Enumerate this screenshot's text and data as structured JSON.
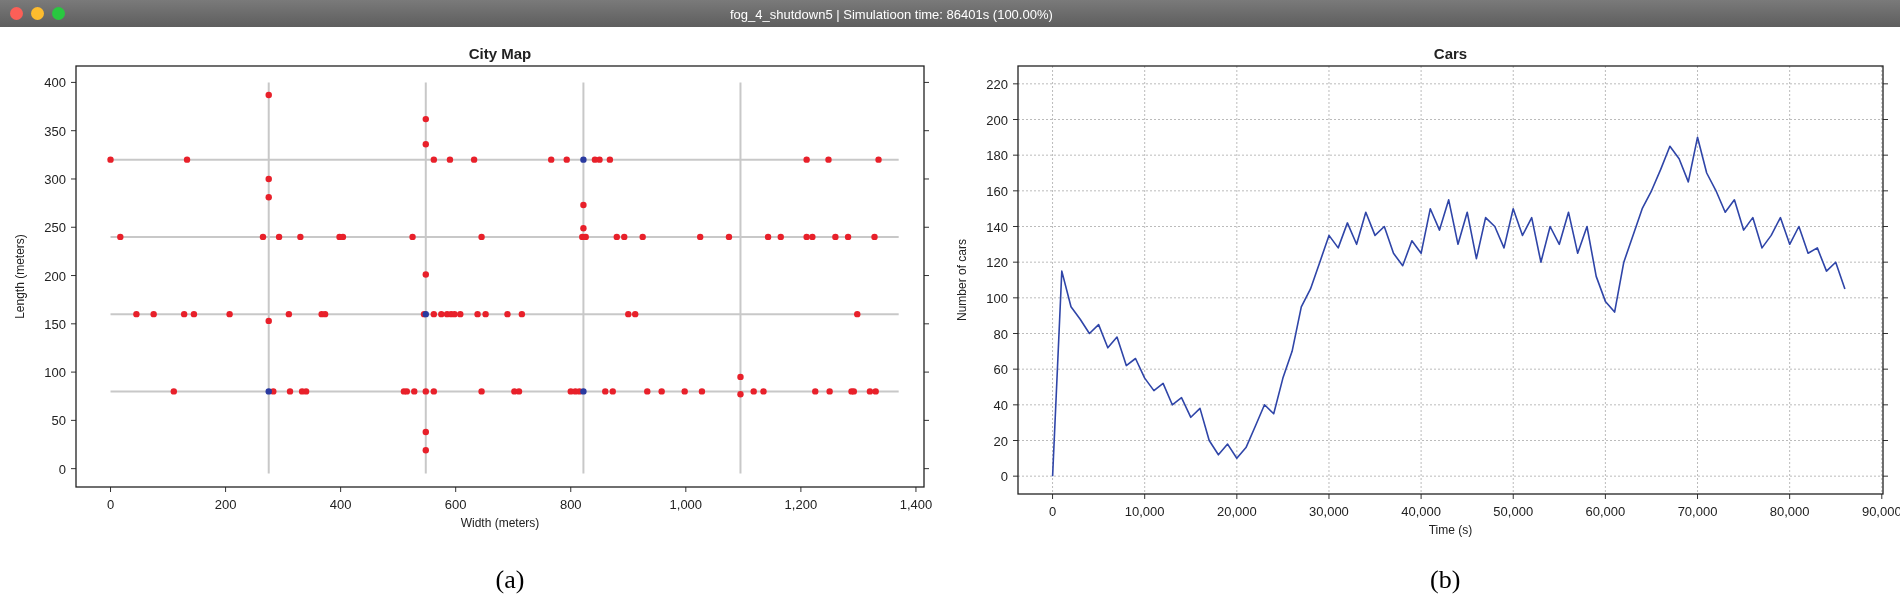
{
  "window": {
    "title": "fog_4_shutdown5 | Simulatioon time: 86401s (100.00%)"
  },
  "city_map": {
    "chart_data": {
      "type": "scatter",
      "title": "City Map",
      "xlabel": "Width (meters)",
      "ylabel": "Length (meters)",
      "xlim": [
        -60,
        1414
      ],
      "ylim": [
        -19,
        417
      ],
      "xticks": [
        0,
        200,
        400,
        600,
        800,
        {
          "value": 1000,
          "label": "1,000"
        },
        {
          "value": 1200,
          "label": "1,200"
        },
        {
          "value": 1400,
          "label": "1,400"
        }
      ],
      "yticks": [
        0,
        50,
        100,
        150,
        200,
        250,
        300,
        350,
        400
      ],
      "series": [
        {
          "color": "#e8202a",
          "x": [
            0,
            133,
            562,
            590,
            632,
            766,
            793,
            842,
            850,
            868,
            1210,
            1248,
            1335,
            275,
            275,
            275,
            275,
            548,
            548,
            548,
            548,
            548,
            822,
            822,
            1095,
            1095,
            17,
            265,
            293,
            330,
            398,
            404,
            525,
            645,
            820,
            826,
            880,
            893,
            925,
            1025,
            1075,
            1143,
            1165,
            1210,
            1220,
            1260,
            1282,
            1328,
            45,
            75,
            128,
            145,
            207,
            310,
            367,
            373,
            545,
            562,
            575,
            585,
            592,
            598,
            608,
            638,
            652,
            690,
            715,
            900,
            912,
            1298,
            110,
            283,
            312,
            333,
            340,
            510,
            515,
            528,
            548,
            562,
            645,
            702,
            710,
            800,
            808,
            815,
            860,
            873,
            933,
            958,
            998,
            1028,
            1118,
            1135,
            1225,
            1250,
            1288,
            1292,
            1320,
            1330
          ],
          "values": [
            320,
            320,
            320,
            320,
            320,
            320,
            320,
            320,
            320,
            320,
            320,
            320,
            320,
            387,
            300,
            281,
            153,
            362,
            336,
            201,
            38,
            19,
            273,
            249,
            95,
            77,
            240,
            240,
            240,
            240,
            240,
            240,
            240,
            240,
            240,
            240,
            240,
            240,
            240,
            240,
            240,
            240,
            240,
            240,
            240,
            240,
            240,
            240,
            160,
            160,
            160,
            160,
            160,
            160,
            160,
            160,
            160,
            160,
            160,
            160,
            160,
            160,
            160,
            160,
            160,
            160,
            160,
            160,
            160,
            160,
            80,
            80,
            80,
            80,
            80,
            80,
            80,
            80,
            80,
            80,
            80,
            80,
            80,
            80,
            80,
            80,
            80,
            80,
            80,
            80,
            80,
            80,
            80,
            80,
            80,
            80,
            80,
            80,
            80,
            80
          ]
        },
        {
          "color": "#2a3aa0",
          "x": [
            822,
            548,
            275,
            822
          ],
          "values": [
            320,
            160,
            80,
            80
          ]
        }
      ],
      "ref_lines": [
        {
          "axis": "y",
          "value": 80
        },
        {
          "axis": "y",
          "value": 160
        },
        {
          "axis": "y",
          "value": 240
        },
        {
          "axis": "y",
          "value": 320
        },
        {
          "axis": "x",
          "value": 275
        },
        {
          "axis": "x",
          "value": 548
        },
        {
          "axis": "x",
          "value": 822
        },
        {
          "axis": "x",
          "value": 1095
        }
      ]
    }
  },
  "cars": {
    "chart_data": {
      "type": "line",
      "title": "Cars",
      "xlabel": "Time (s)",
      "ylabel": "Number of cars",
      "xlim": [
        -3750,
        90130
      ],
      "ylim": [
        -10,
        230
      ],
      "xticks": [
        0,
        {
          "value": 10000,
          "label": "10,000"
        },
        {
          "value": 20000,
          "label": "20,000"
        },
        {
          "value": 30000,
          "label": "30,000"
        },
        {
          "value": 40000,
          "label": "40,000"
        },
        {
          "value": 50000,
          "label": "50,000"
        },
        {
          "value": 60000,
          "label": "60,000"
        },
        {
          "value": 70000,
          "label": "70,000"
        },
        {
          "value": 80000,
          "label": "80,000"
        },
        {
          "value": 90000,
          "label": "90,000"
        }
      ],
      "yticks": [
        0,
        20,
        40,
        60,
        80,
        100,
        120,
        140,
        160,
        180,
        200,
        220
      ],
      "x": [
        0,
        1000,
        2000,
        3000,
        4000,
        5000,
        6000,
        7000,
        8000,
        9000,
        10000,
        11000,
        12000,
        13000,
        14000,
        15000,
        16000,
        17000,
        18000,
        19000,
        20000,
        21000,
        22000,
        23000,
        24000,
        25000,
        26000,
        27000,
        28000,
        29000,
        30000,
        31000,
        32000,
        33000,
        34000,
        35000,
        36000,
        37000,
        38000,
        39000,
        40000,
        41000,
        42000,
        43000,
        44000,
        45000,
        46000,
        47000,
        48000,
        49000,
        50000,
        51000,
        52000,
        53000,
        54000,
        55000,
        56000,
        57000,
        58000,
        59000,
        60000,
        61000,
        62000,
        63000,
        64000,
        65000,
        66000,
        67000,
        68000,
        69000,
        70000,
        71000,
        72000,
        73000,
        74000,
        75000,
        76000,
        77000,
        78000,
        79000,
        80000,
        81000,
        82000,
        83000,
        84000,
        85000,
        86000
      ],
      "grid": true,
      "series": [
        {
          "color": "#2f45a8",
          "values": [
            0,
            115,
            95,
            88,
            80,
            85,
            72,
            78,
            62,
            66,
            55,
            48,
            52,
            40,
            44,
            33,
            38,
            20,
            12,
            18,
            10,
            16,
            28,
            40,
            35,
            55,
            70,
            95,
            105,
            120,
            135,
            128,
            142,
            130,
            148,
            135,
            140,
            125,
            118,
            132,
            125,
            150,
            138,
            155,
            130,
            148,
            122,
            145,
            140,
            128,
            150,
            135,
            145,
            120,
            140,
            130,
            148,
            125,
            140,
            112,
            98,
            92,
            120,
            135,
            150,
            160,
            172,
            185,
            178,
            165,
            190,
            170,
            160,
            148,
            155,
            138,
            145,
            128,
            135,
            145,
            130,
            140,
            125,
            128,
            115,
            120,
            105
          ]
        }
      ]
    }
  },
  "captions": [
    "(a)",
    "(b)"
  ]
}
